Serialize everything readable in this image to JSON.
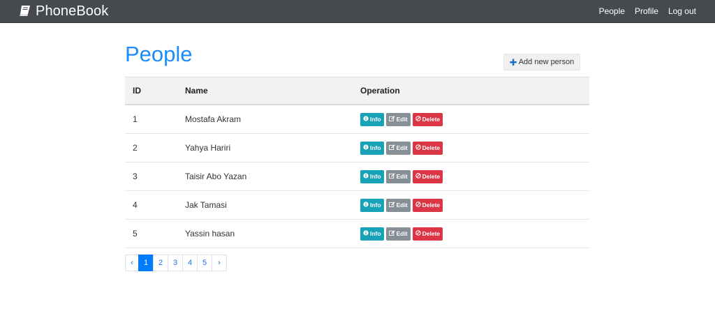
{
  "navbar": {
    "brand": "PhoneBook",
    "brand_icon": "book-icon",
    "links": [
      "People",
      "Profile",
      "Log out"
    ]
  },
  "page": {
    "title": "People",
    "add_button": "Add new person",
    "add_icon": "plus-icon"
  },
  "table": {
    "headers": [
      "ID",
      "Name",
      "Operation"
    ],
    "rows": [
      {
        "id": "1",
        "name": "Mostafa Akram"
      },
      {
        "id": "2",
        "name": "Yahya Hariri"
      },
      {
        "id": "3",
        "name": "Taisir Abo Yazan"
      },
      {
        "id": "4",
        "name": "Jak Tamasi"
      },
      {
        "id": "5",
        "name": "Yassin hasan"
      }
    ],
    "actions": {
      "info": "Info",
      "edit": "Edit",
      "delete": "Delete"
    }
  },
  "pagination": {
    "prev": "‹",
    "pages": [
      "1",
      "2",
      "3",
      "4",
      "5"
    ],
    "next": "›",
    "active": "1"
  },
  "colors": {
    "navbar": "#464a4f",
    "title": "#1a8cff",
    "info": "#17a2b8",
    "edit": "#868e96",
    "delete": "#dc3545",
    "page_active": "#007bff"
  }
}
